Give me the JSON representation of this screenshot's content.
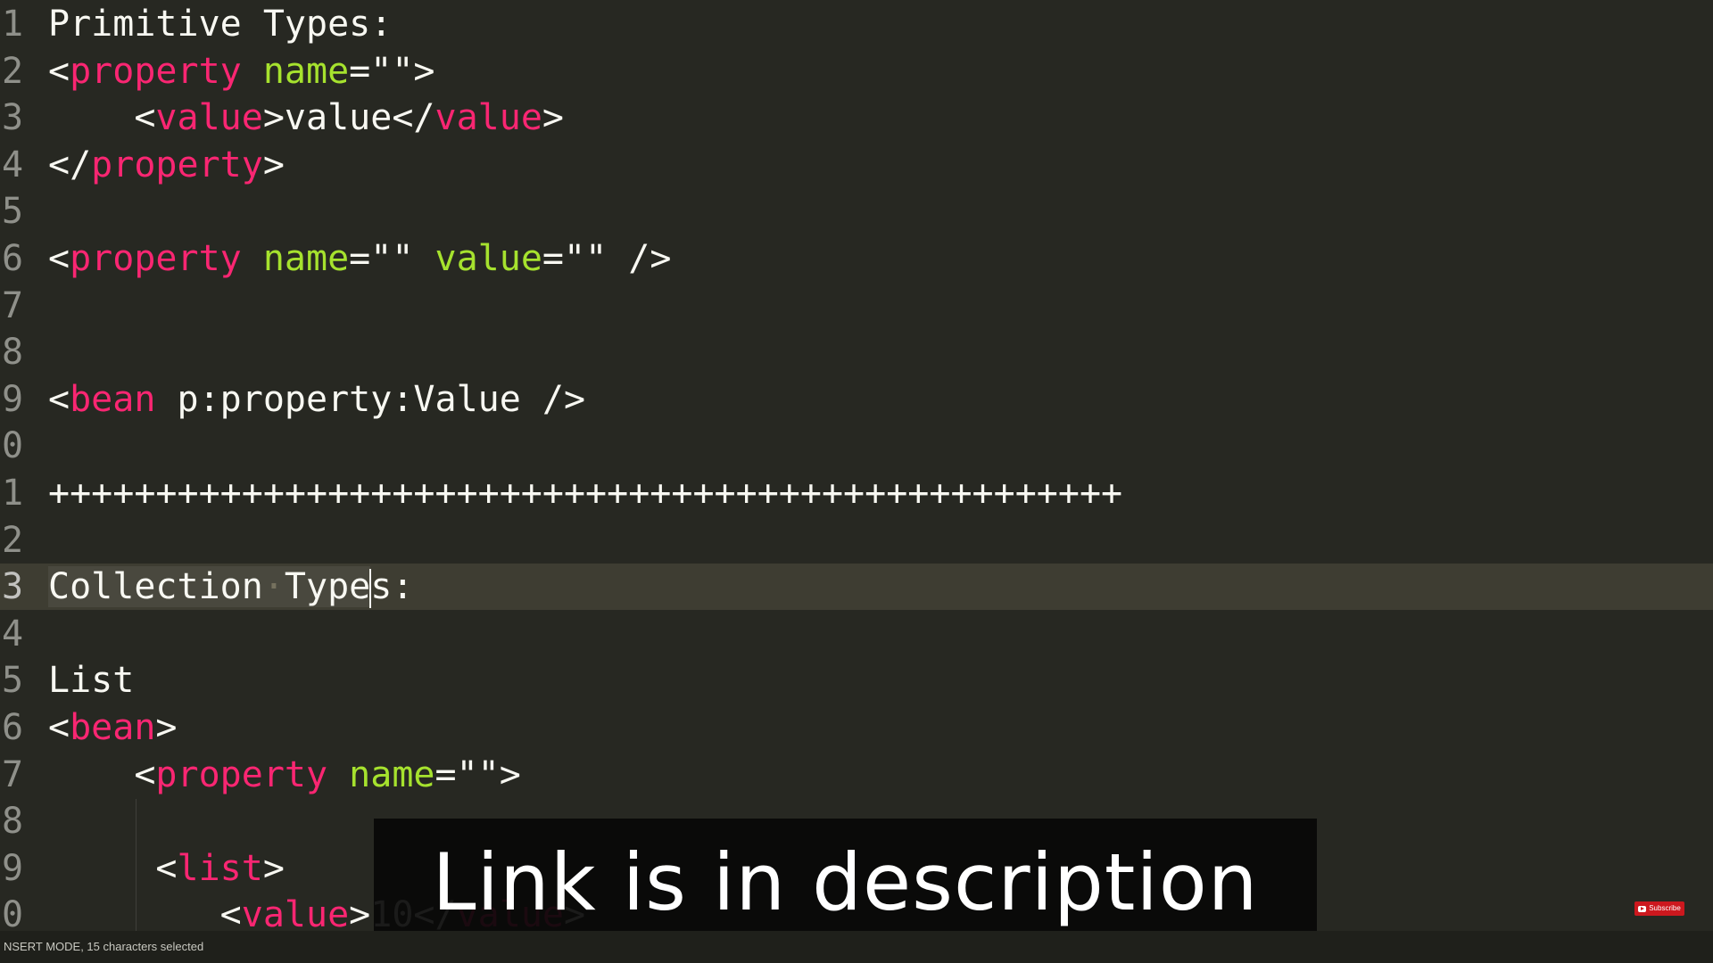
{
  "editor": {
    "lines": [
      {
        "num": "1",
        "segments": [
          {
            "t": "Primitive Types:",
            "c": "plain"
          }
        ]
      },
      {
        "num": "2",
        "segments": [
          {
            "t": "<",
            "c": "plain"
          },
          {
            "t": "property",
            "c": "tag"
          },
          {
            "t": " ",
            "c": "plain"
          },
          {
            "t": "name",
            "c": "attr"
          },
          {
            "t": "=\"\">",
            "c": "plain"
          }
        ]
      },
      {
        "num": "3",
        "segments": [
          {
            "t": "    <",
            "c": "plain"
          },
          {
            "t": "value",
            "c": "tag"
          },
          {
            "t": ">value</",
            "c": "plain"
          },
          {
            "t": "value",
            "c": "tag"
          },
          {
            "t": ">",
            "c": "plain"
          }
        ]
      },
      {
        "num": "4",
        "segments": [
          {
            "t": "</",
            "c": "plain"
          },
          {
            "t": "property",
            "c": "tag"
          },
          {
            "t": ">",
            "c": "plain"
          }
        ]
      },
      {
        "num": "5",
        "segments": []
      },
      {
        "num": "6",
        "segments": [
          {
            "t": "<",
            "c": "plain"
          },
          {
            "t": "property",
            "c": "tag"
          },
          {
            "t": " ",
            "c": "plain"
          },
          {
            "t": "name",
            "c": "attr"
          },
          {
            "t": "=\"\" ",
            "c": "plain"
          },
          {
            "t": "value",
            "c": "attr"
          },
          {
            "t": "=\"\" />",
            "c": "plain"
          }
        ]
      },
      {
        "num": "7",
        "segments": []
      },
      {
        "num": "8",
        "segments": []
      },
      {
        "num": "9",
        "segments": [
          {
            "t": "<",
            "c": "plain"
          },
          {
            "t": "bean",
            "c": "tag"
          },
          {
            "t": " p:property:Value />",
            "c": "plain"
          }
        ]
      },
      {
        "num": "0",
        "segments": []
      },
      {
        "num": "1",
        "segments": [
          {
            "t": "++++++++++++++++++++++++++++++++++++++++++++++++++",
            "c": "plain"
          }
        ]
      },
      {
        "num": "2",
        "segments": []
      },
      {
        "num": "3",
        "current": true,
        "segments": [
          {
            "t": "Collection",
            "c": "plain sel"
          },
          {
            "t": "·",
            "c": "ws-dot sel"
          },
          {
            "t": "Type",
            "c": "plain sel"
          },
          {
            "caret": true
          },
          {
            "t": "s:",
            "c": "plain"
          }
        ]
      },
      {
        "num": "4",
        "segments": []
      },
      {
        "num": "5",
        "segments": [
          {
            "t": "List",
            "c": "plain"
          }
        ]
      },
      {
        "num": "6",
        "segments": [
          {
            "t": "<",
            "c": "plain"
          },
          {
            "t": "bean",
            "c": "tag"
          },
          {
            "t": ">",
            "c": "plain"
          }
        ]
      },
      {
        "num": "7",
        "segments": [
          {
            "t": "    <",
            "c": "plain"
          },
          {
            "t": "property",
            "c": "tag"
          },
          {
            "t": " ",
            "c": "plain"
          },
          {
            "t": "name",
            "c": "attr"
          },
          {
            "t": "=\"\">",
            "c": "plain"
          }
        ]
      },
      {
        "num": "8",
        "segments": []
      },
      {
        "num": "9",
        "segments": [
          {
            "t": "     <",
            "c": "plain"
          },
          {
            "t": "list",
            "c": "tag"
          },
          {
            "t": ">",
            "c": "plain"
          }
        ]
      },
      {
        "num": "0",
        "segments": [
          {
            "t": "        <",
            "c": "plain"
          },
          {
            "t": "value",
            "c": "tag"
          },
          {
            "t": ">10</",
            "c": "plain"
          },
          {
            "t": "value",
            "c": "tag"
          },
          {
            "t": ">",
            "c": "plain"
          }
        ]
      }
    ]
  },
  "caption": {
    "text": "Link is in description"
  },
  "statusbar": {
    "text": "NSERT MODE, 15 characters selected"
  },
  "subscribe": {
    "label": "Subscribe"
  },
  "colors": {
    "background": "#272822",
    "tag": "#f92672",
    "attribute": "#a6e22e",
    "text": "#f8f8f2",
    "gutter": "#8f908a"
  }
}
